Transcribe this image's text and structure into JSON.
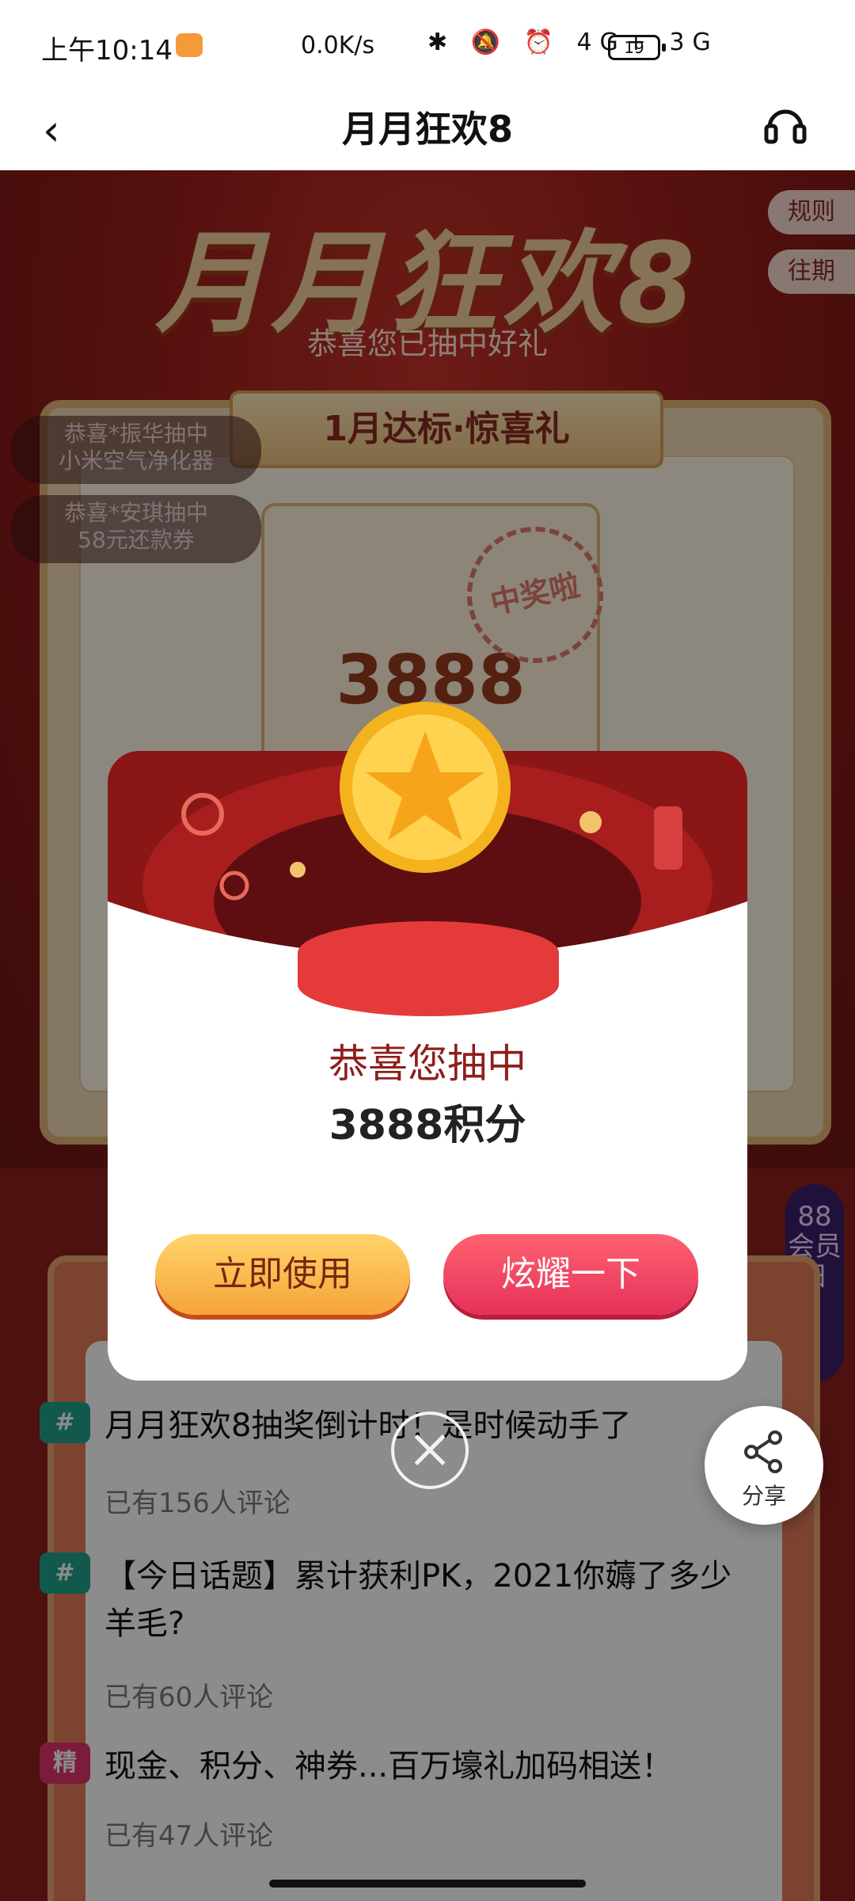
{
  "status_bar": {
    "time": "上午10:14",
    "speed": "0.0K/s",
    "icons": "✱ 🔕 ⏰ 4G+ 3G",
    "battery": "19"
  },
  "nav": {
    "back_icon": "‹",
    "title": "月月狂欢8",
    "support_icon": "headphones-icon"
  },
  "hero": {
    "title": "月月狂欢8",
    "subtitle": "恭喜您已抽中好礼",
    "side_buttons": [
      "规则",
      "往期"
    ]
  },
  "board": {
    "title": "1月达标·惊喜礼",
    "prize_value": "3888",
    "stamp_text": "中奖啦",
    "tickers": [
      {
        "line1": "恭喜*振华抽中",
        "line2": "小米空气净化器"
      },
      {
        "line1": "恭喜*安琪抽中",
        "line2": "58元还款券"
      }
    ]
  },
  "member_tab": {
    "label": "88会员日"
  },
  "topics": [
    {
      "tag": "#",
      "tag_color": "#1fa28a",
      "title": "月月狂欢8抽奖倒计时！是时候动手了",
      "count": "已有156人评论"
    },
    {
      "tag": "#",
      "tag_color": "#1fa28a",
      "title": "【今日话题】累计获利PK，2021你薅了多少羊毛?",
      "count": "已有60人评论"
    },
    {
      "tag": "精",
      "tag_color": "#e0336b",
      "title": "现金、积分、神券...百万壕礼加码相送！",
      "count": "已有47人评论"
    }
  ],
  "share": {
    "label": "分享"
  },
  "modal": {
    "title": "恭喜您抽中",
    "prize": "3888积分",
    "use_button": "立即使用",
    "show_button": "炫耀一下"
  },
  "colors": {
    "brand_red": "#c8332a",
    "gold": "#f2cf9f",
    "dark_red_text": "#8e1f1c"
  }
}
